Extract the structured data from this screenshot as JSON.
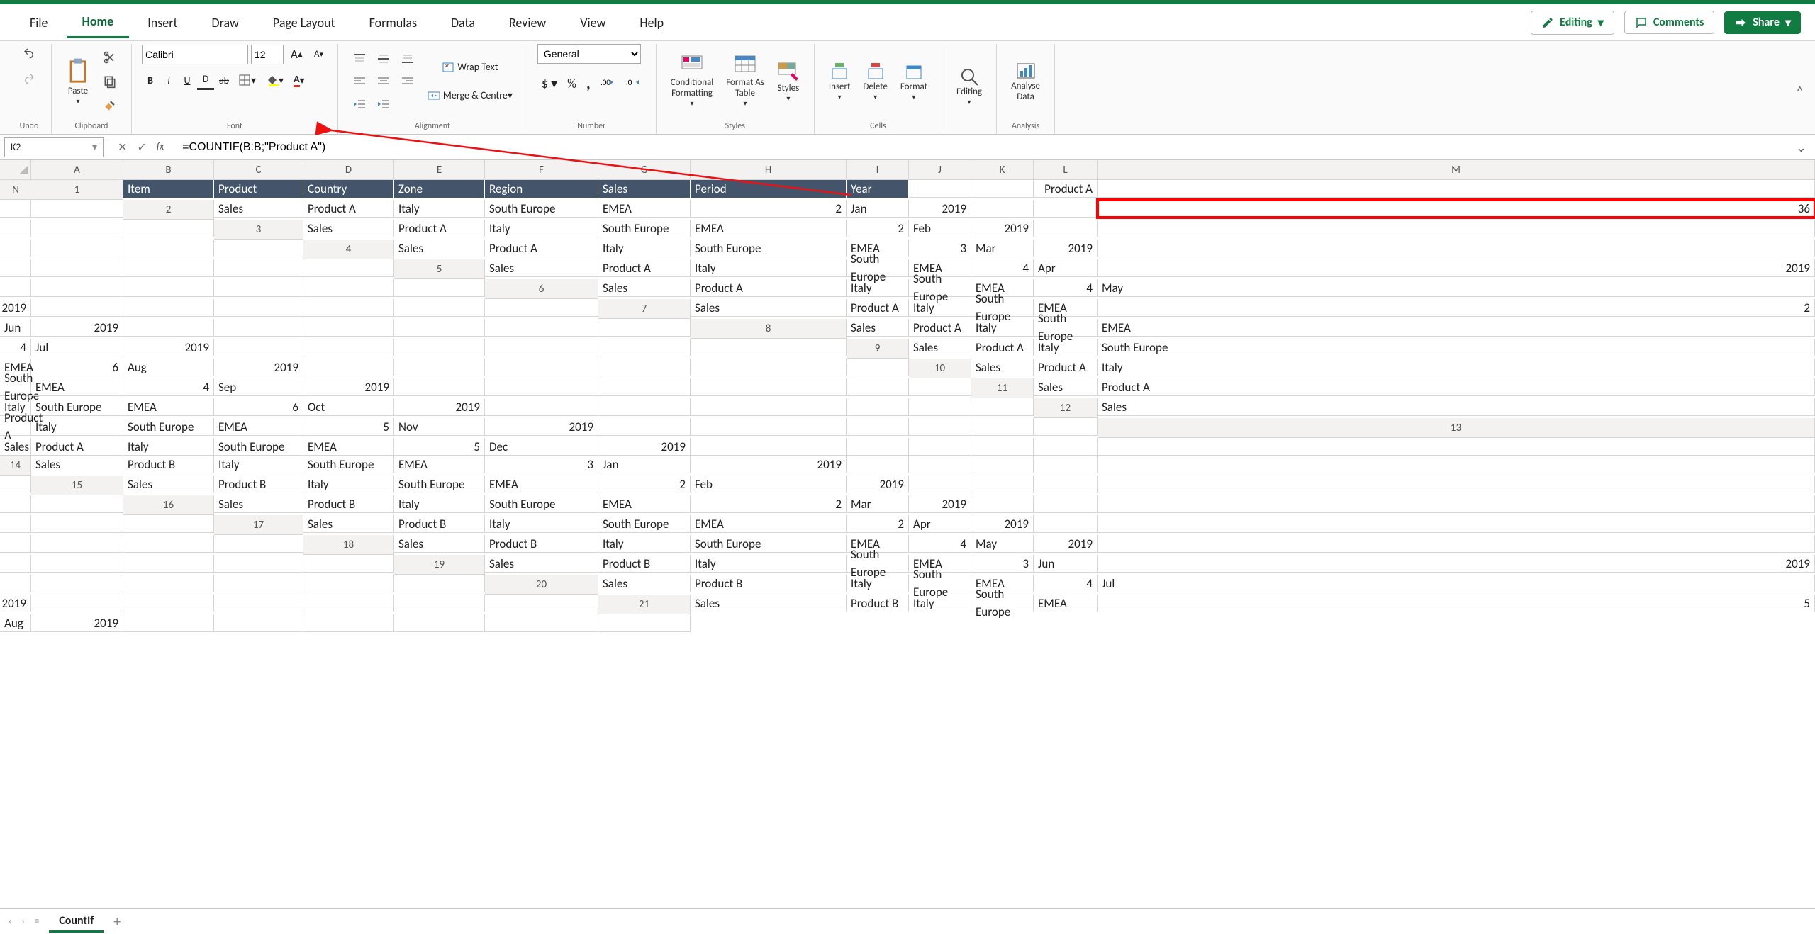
{
  "tabs": {
    "file": "File",
    "home": "Home",
    "insert": "Insert",
    "draw": "Draw",
    "page_layout": "Page Layout",
    "formulas": "Formulas",
    "data": "Data",
    "review": "Review",
    "view": "View",
    "help": "Help"
  },
  "top_buttons": {
    "editing": "Editing",
    "comments": "Comments",
    "share": "Share"
  },
  "ribbon": {
    "undo": "Undo",
    "clipboard": "Clipboard",
    "paste": "Paste",
    "font": "Font",
    "font_name": "Calibri",
    "font_size": "12",
    "alignment": "Alignment",
    "wrap": "Wrap Text",
    "merge": "Merge & Centre",
    "number": "Number",
    "num_format": "General",
    "styles": "Styles",
    "cond": "Conditional",
    "cond2": "Formatting",
    "fmtas": "Format As",
    "fmtas2": "Table",
    "sty": "Styles",
    "cells": "Cells",
    "ins": "Insert",
    "del": "Delete",
    "fmt": "Format",
    "editing": "Editing",
    "analysis": "Analysis",
    "analyse": "Analyse",
    "analyse2": "Data"
  },
  "namebox": "K2",
  "formula": "=COUNTIF(B:B;\"Product A\")",
  "columns": [
    "A",
    "B",
    "C",
    "D",
    "E",
    "F",
    "G",
    "H",
    "I",
    "J",
    "K",
    "L",
    "M",
    "N"
  ],
  "row_numbers": [
    1,
    2,
    3,
    4,
    5,
    6,
    7,
    8,
    9,
    10,
    11,
    12,
    13,
    14,
    15,
    16,
    17,
    18,
    19,
    20,
    21
  ],
  "headers": [
    "Item",
    "Product",
    "Country",
    "Zone",
    "Region",
    "Sales",
    "Period",
    "Year"
  ],
  "K1": "Product A",
  "K2": "36",
  "rows": [
    {
      "item": "Sales",
      "product": "Product A",
      "country": "Italy",
      "zone": "South Europe",
      "region": "EMEA",
      "sales": 2,
      "period": "Jan",
      "year": 2019
    },
    {
      "item": "Sales",
      "product": "Product A",
      "country": "Italy",
      "zone": "South Europe",
      "region": "EMEA",
      "sales": 2,
      "period": "Feb",
      "year": 2019
    },
    {
      "item": "Sales",
      "product": "Product A",
      "country": "Italy",
      "zone": "South Europe",
      "region": "EMEA",
      "sales": 3,
      "period": "Mar",
      "year": 2019
    },
    {
      "item": "Sales",
      "product": "Product A",
      "country": "Italy",
      "zone": "South Europe",
      "region": "EMEA",
      "sales": 4,
      "period": "Apr",
      "year": 2019
    },
    {
      "item": "Sales",
      "product": "Product A",
      "country": "Italy",
      "zone": "South Europe",
      "region": "EMEA",
      "sales": 4,
      "period": "May",
      "year": 2019
    },
    {
      "item": "Sales",
      "product": "Product A",
      "country": "Italy",
      "zone": "South Europe",
      "region": "EMEA",
      "sales": 2,
      "period": "Jun",
      "year": 2019
    },
    {
      "item": "Sales",
      "product": "Product A",
      "country": "Italy",
      "zone": "South Europe",
      "region": "EMEA",
      "sales": 4,
      "period": "Jul",
      "year": 2019
    },
    {
      "item": "Sales",
      "product": "Product A",
      "country": "Italy",
      "zone": "South Europe",
      "region": "EMEA",
      "sales": 6,
      "period": "Aug",
      "year": 2019
    },
    {
      "item": "Sales",
      "product": "Product A",
      "country": "Italy",
      "zone": "South Europe",
      "region": "EMEA",
      "sales": 4,
      "period": "Sep",
      "year": 2019
    },
    {
      "item": "Sales",
      "product": "Product A",
      "country": "Italy",
      "zone": "South Europe",
      "region": "EMEA",
      "sales": 6,
      "period": "Oct",
      "year": 2019
    },
    {
      "item": "Sales",
      "product": "Product A",
      "country": "Italy",
      "zone": "South Europe",
      "region": "EMEA",
      "sales": 5,
      "period": "Nov",
      "year": 2019
    },
    {
      "item": "Sales",
      "product": "Product A",
      "country": "Italy",
      "zone": "South Europe",
      "region": "EMEA",
      "sales": 5,
      "period": "Dec",
      "year": 2019
    },
    {
      "item": "Sales",
      "product": "Product B",
      "country": "Italy",
      "zone": "South Europe",
      "region": "EMEA",
      "sales": 3,
      "period": "Jan",
      "year": 2019
    },
    {
      "item": "Sales",
      "product": "Product B",
      "country": "Italy",
      "zone": "South Europe",
      "region": "EMEA",
      "sales": 2,
      "period": "Feb",
      "year": 2019
    },
    {
      "item": "Sales",
      "product": "Product B",
      "country": "Italy",
      "zone": "South Europe",
      "region": "EMEA",
      "sales": 2,
      "period": "Mar",
      "year": 2019
    },
    {
      "item": "Sales",
      "product": "Product B",
      "country": "Italy",
      "zone": "South Europe",
      "region": "EMEA",
      "sales": 2,
      "period": "Apr",
      "year": 2019
    },
    {
      "item": "Sales",
      "product": "Product B",
      "country": "Italy",
      "zone": "South Europe",
      "region": "EMEA",
      "sales": 4,
      "period": "May",
      "year": 2019
    },
    {
      "item": "Sales",
      "product": "Product B",
      "country": "Italy",
      "zone": "South Europe",
      "region": "EMEA",
      "sales": 3,
      "period": "Jun",
      "year": 2019
    },
    {
      "item": "Sales",
      "product": "Product B",
      "country": "Italy",
      "zone": "South Europe",
      "region": "EMEA",
      "sales": 4,
      "period": "Jul",
      "year": 2019
    },
    {
      "item": "Sales",
      "product": "Product B",
      "country": "Italy",
      "zone": "South Europe",
      "region": "EMEA",
      "sales": 5,
      "period": "Aug",
      "year": 2019
    }
  ],
  "sheet_tab": "CountIf"
}
